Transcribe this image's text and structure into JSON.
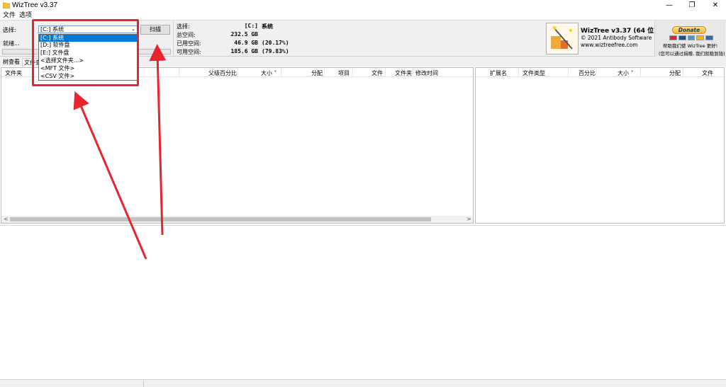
{
  "window": {
    "title": "WizTree v3.37",
    "minimize_glyph": "—",
    "maximize_glyph": "❐",
    "close_glyph": "✕"
  },
  "menu": {
    "file": "文件",
    "options": "选项"
  },
  "scan_panel": {
    "select_label": "选择:",
    "selected_drive": "[C:] 系统",
    "dropdown_arrow": "⌄",
    "scan_button": "扫描",
    "status_label": "就绪..."
  },
  "drive_options": [
    "[C:] 系统",
    "[D:] 软件盘",
    "[E:] 文件盘",
    "<选择文件夹...>",
    "<MFT 文件>",
    "<CSV 文件>"
  ],
  "drive_info": {
    "select_label": "选择:",
    "drive": "[C:]",
    "drive_name": "系统",
    "total_label": "总空间:",
    "total_value": "232.5 GB",
    "used_label": "已用空间:",
    "used_value": "46.9 GB",
    "used_pct": "(20.17%)",
    "free_label": "可用空间:",
    "free_value": "185.6 GB",
    "free_pct": "(79.83%)"
  },
  "brand": {
    "name": "WizTree v3.37 (64 位)",
    "copyright": "© 2021 Antibody Software",
    "website": "www.wiztreefree.com"
  },
  "donate": {
    "button": "Donate",
    "line1": "帮助我们使 WizTree 更好!",
    "line2": "(您可以通过捐赠, 我们就稳到钱)"
  },
  "tabs": {
    "tree_view": "树查看",
    "file_view": "文件查"
  },
  "left_columns": [
    "文件夹",
    "父级百分比",
    "大小 ˅",
    "分配",
    "项目",
    "文件",
    "文件夹",
    "修改时间"
  ],
  "right_columns": [
    "扩展名",
    "文件类型",
    "百分比",
    "大小 ˅",
    "分配",
    "文件"
  ],
  "scroll": {
    "left": "<",
    "right": ">"
  },
  "colors": {
    "highlight": "#e8242f",
    "selection": "#0078d7",
    "panel_bg": "#f0f0f0"
  }
}
